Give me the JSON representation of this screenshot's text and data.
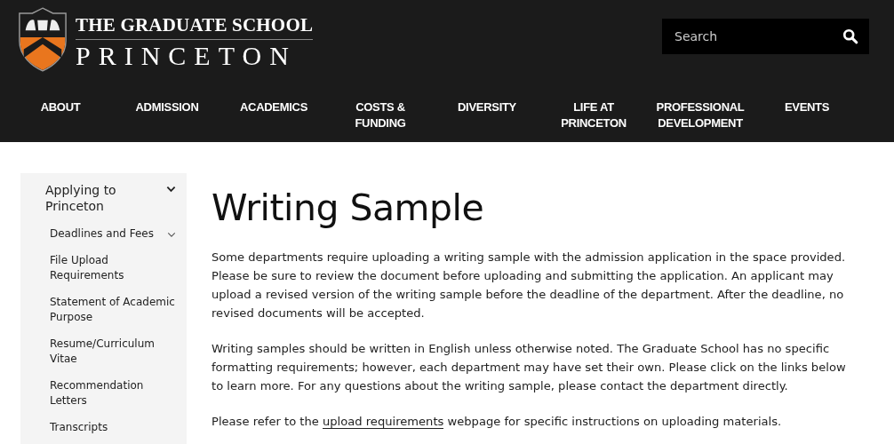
{
  "header": {
    "logo": {
      "line_1": "THE GRADUATE SCHOOL",
      "line_2": "PRINCETON"
    },
    "search": {
      "placeholder": "Search"
    },
    "nav": [
      {
        "label": "ABOUT"
      },
      {
        "label": "ADMISSION"
      },
      {
        "label": "ACADEMICS"
      },
      {
        "label": "COSTS & FUNDING"
      },
      {
        "label": "DIVERSITY"
      },
      {
        "label": "LIFE AT PRINCETON"
      },
      {
        "label": "PROFESSIONAL DEVELOPMENT"
      },
      {
        "label": "EVENTS"
      }
    ]
  },
  "sidebar": {
    "items": [
      {
        "label": "Applying to Princeton",
        "expandable": true,
        "children": [
          {
            "label": "Deadlines and Fees",
            "expandable": true
          },
          {
            "label": "File Upload Requirements",
            "expandable": false
          },
          {
            "label": "Statement of Academic Purpose",
            "expandable": false
          },
          {
            "label": "Resume/Curriculum Vitae",
            "expandable": false
          },
          {
            "label": "Recommendation Letters",
            "expandable": false
          },
          {
            "label": "Transcripts",
            "expandable": false
          }
        ]
      }
    ]
  },
  "main": {
    "title": "Writing Sample",
    "paragraphs": [
      {
        "text": "Some departments require uploading a writing sample with the admission application in the space provided. Please be sure to review the document before uploading and submitting the application. An applicant may upload a revised version of the writing sample before the deadline of the department. After the deadline, no revised documents will be accepted."
      },
      {
        "text": "Writing samples should be written in English unless otherwise noted. The Graduate School has no specific formatting requirements; however, each department may have set their own.  Please click on the links below to learn more. For any questions about the writing sample, please contact the department directly."
      },
      {
        "before": "Please refer to the ",
        "link": "upload requirements",
        "after": " webpage for specific instructions on uploading materials."
      }
    ]
  }
}
